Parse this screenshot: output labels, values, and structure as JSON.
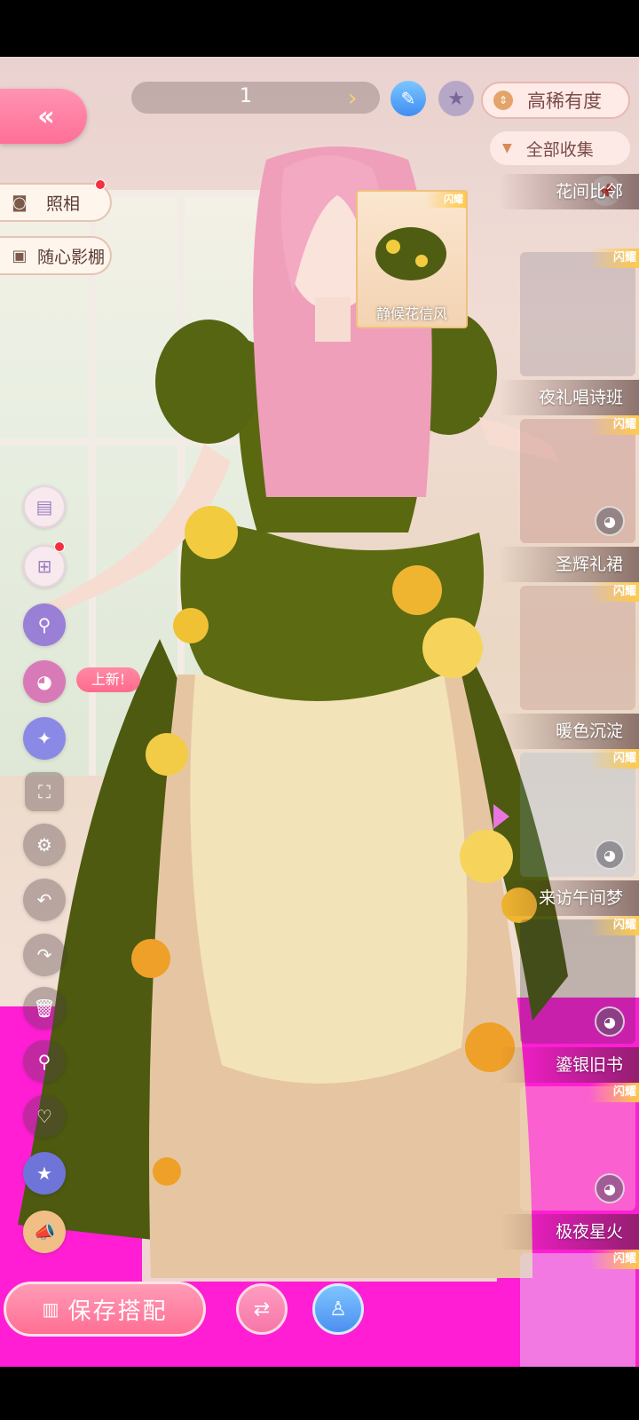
{
  "topbar": {
    "back_glyph": "«",
    "page_number": "1",
    "page_arrow": "›",
    "sort_label": "高稀有度",
    "filter_label": "全部收集"
  },
  "left_menu": {
    "photo_label": "照相",
    "studio_label": "随心影棚",
    "new_tag": "上新!"
  },
  "preview": {
    "badge": "闪耀",
    "name": "静候花信风"
  },
  "items": [
    {
      "name": "花间比邻",
      "badge": "闪耀"
    },
    {
      "name": "夜礼唱诗班",
      "badge": "闪耀"
    },
    {
      "name": "圣辉礼裙",
      "badge": "闪耀"
    },
    {
      "name": "暖色沉淀",
      "badge": "闪耀"
    },
    {
      "name": "来访午间梦",
      "badge": "闪耀"
    },
    {
      "name": "鎏银旧书",
      "badge": "闪耀"
    },
    {
      "name": "极夜星火",
      "badge": "闪耀"
    },
    {
      "name": "",
      "badge": "闪耀"
    }
  ],
  "bottom": {
    "save_label": "保存搭配"
  },
  "colors": {
    "accent_pink": "#ff7a9c",
    "magenta_bg": "#ff1ed4",
    "dress_green": "#5c6a12",
    "skirt_cream": "#f3e3b8",
    "hair_pink": "#f0a3bd"
  },
  "icons": [
    "back-icon",
    "edit-icon",
    "star-icon",
    "sort-icon",
    "filter-icon",
    "camera-icon",
    "studio-box-icon",
    "wardrobe-icon",
    "add-layer-icon",
    "search-swap-icon",
    "palette-icon",
    "sparkle-icon",
    "fullscreen-icon",
    "gear-icon",
    "undo-icon",
    "redo-icon",
    "trash-icon",
    "search-icon",
    "heart-icon",
    "favorite-star-icon",
    "megaphone-icon",
    "pin-icon",
    "dye-palette-icon",
    "swap-icon",
    "mannequin-icon"
  ]
}
